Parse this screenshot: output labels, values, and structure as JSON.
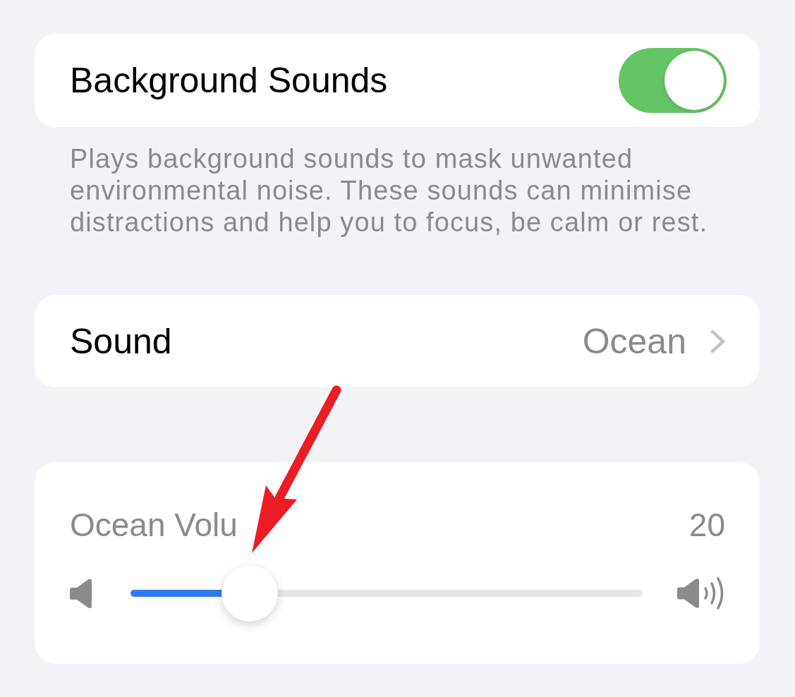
{
  "background_sounds": {
    "label": "Background Sounds",
    "on": true
  },
  "description": "Plays background sounds to mask unwanted environmental noise. These sounds can minimise distractions and help you to focus, be calm or rest.",
  "sound": {
    "label": "Sound",
    "value": "Ocean"
  },
  "volume": {
    "label": "Ocean Volu",
    "reading": "20",
    "level": 0.2
  }
}
